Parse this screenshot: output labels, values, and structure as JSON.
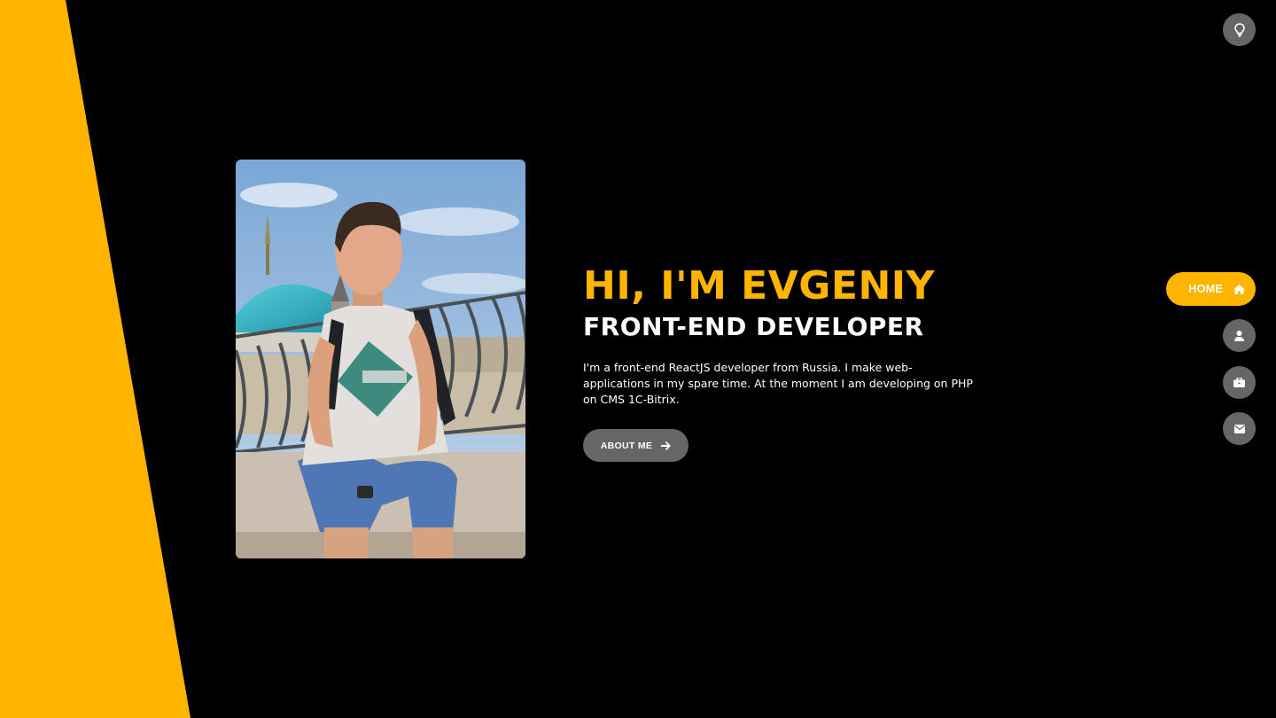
{
  "colors": {
    "accent": "#ffb400",
    "background": "#000000",
    "button_gray": "#666666",
    "text_white": "#ffffff"
  },
  "theme_toggle": {
    "icon": "lightbulb-icon"
  },
  "hero": {
    "greeting": "HI, I'M EVGENIY",
    "role": "FRONT-END DEVELOPER",
    "description": "I'm a front-end ReactJS developer from Russia. I make web-applications in my spare time. At the moment I am developing on PHP on CMS 1C-Bitrix.",
    "about_button_label": "ABOUT ME",
    "about_button_icon": "arrow-right-icon"
  },
  "nav": {
    "home_label": "HOME",
    "home_icon": "home-icon",
    "about_icon": "user-icon",
    "portfolio_icon": "briefcase-icon",
    "contact_icon": "envelope-icon"
  }
}
